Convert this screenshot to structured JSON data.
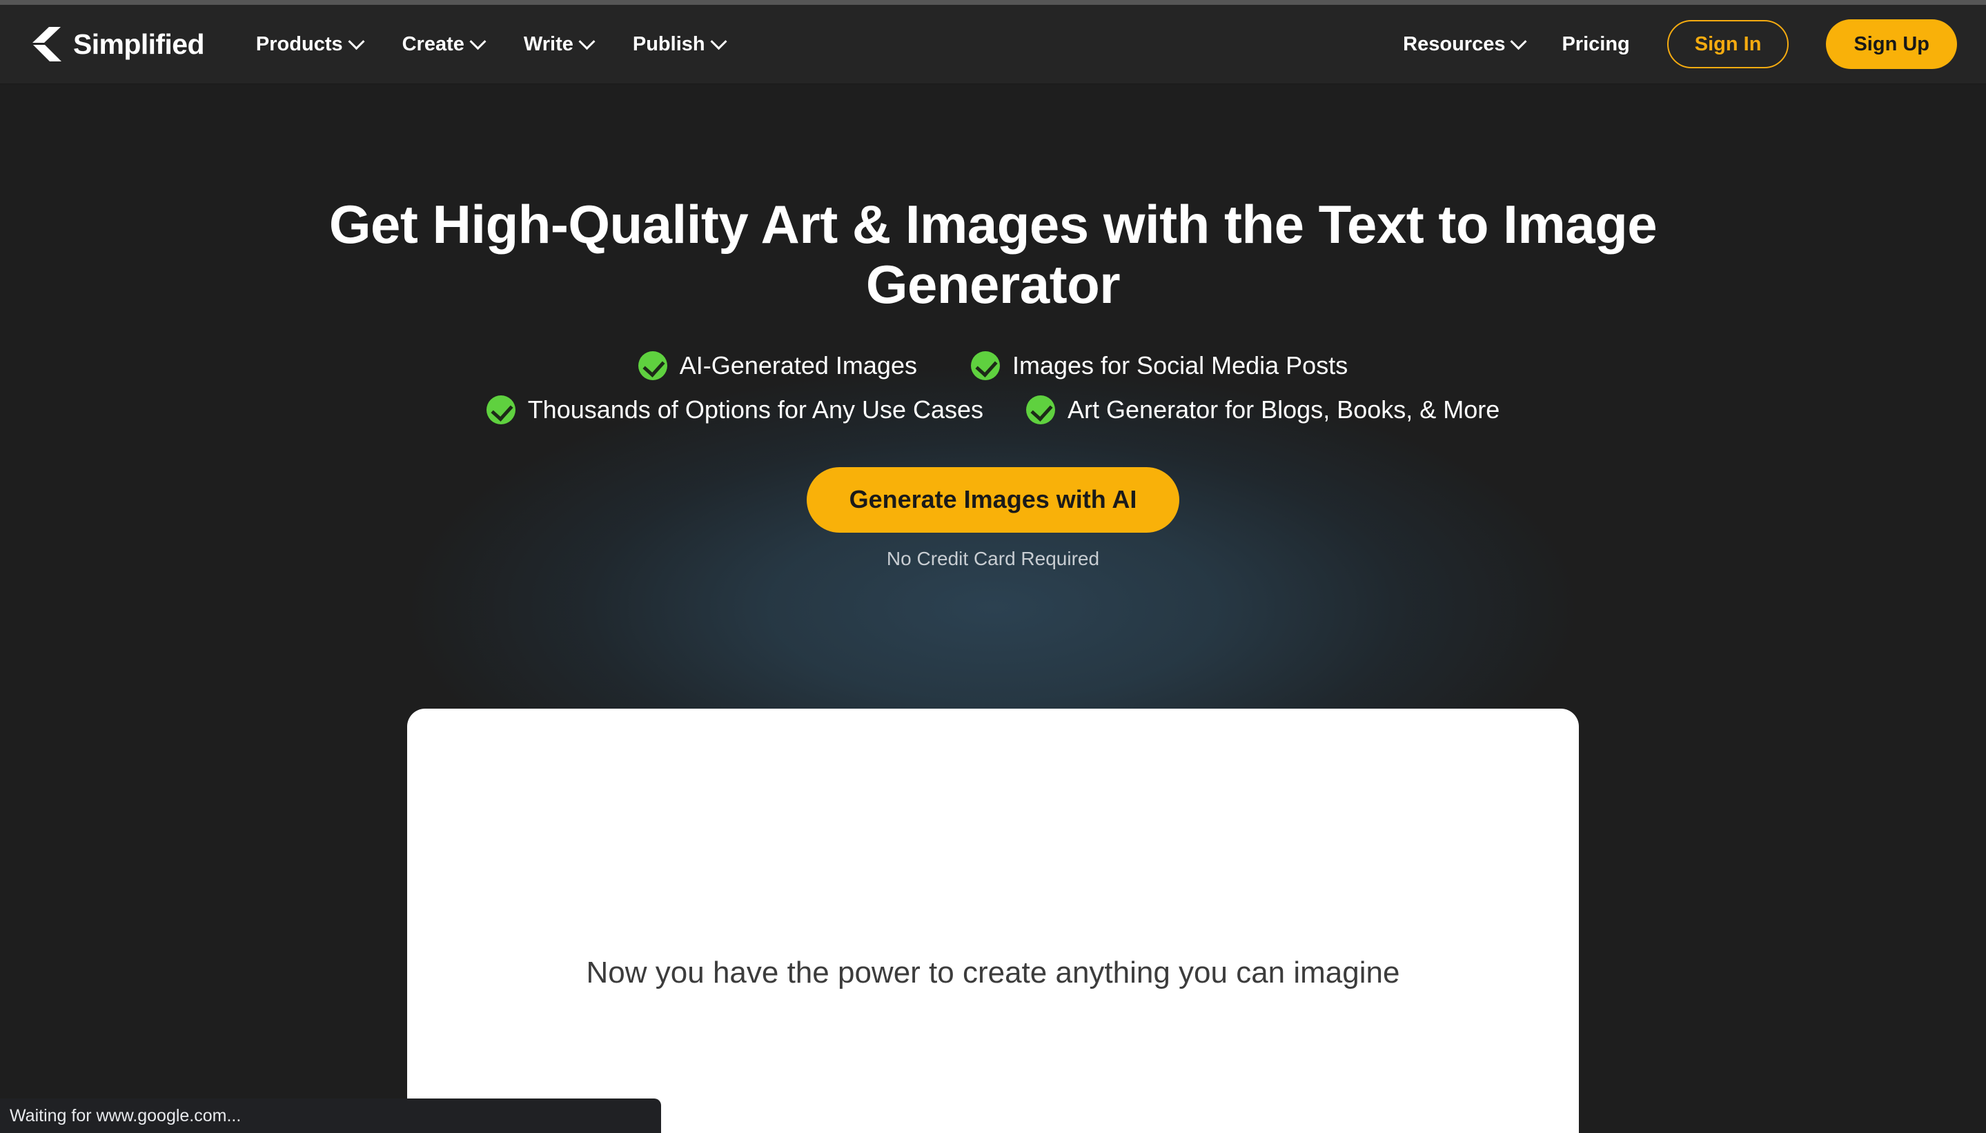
{
  "theme": {
    "page_bg": "#1e1e1e",
    "header_bg": "#252525",
    "accent_amber": "#f9b109",
    "accent_amber_border": "#f5ab10",
    "check_green": "#5fd13f",
    "glow_blue": "#2c4252",
    "card_bg": "#ffffff",
    "status_bg": "#202124"
  },
  "header": {
    "brand_name": "Simplified",
    "brand_logo_icon": "simplified-logo-icon",
    "nav_items": [
      {
        "label": "Products",
        "has_dropdown": true,
        "icon": "chevron-down-icon"
      },
      {
        "label": "Create",
        "has_dropdown": true,
        "icon": "chevron-down-icon"
      },
      {
        "label": "Write",
        "has_dropdown": true,
        "icon": "chevron-down-icon"
      },
      {
        "label": "Publish",
        "has_dropdown": true,
        "icon": "chevron-down-icon"
      }
    ],
    "right_items": [
      {
        "label": "Resources",
        "has_dropdown": true,
        "icon": "chevron-down-icon"
      },
      {
        "label": "Pricing",
        "has_dropdown": false
      }
    ],
    "sign_in_label": "Sign In",
    "sign_up_label": "Sign Up"
  },
  "hero": {
    "title": "Get High-Quality Art & Images with the Text to Image Generator",
    "features": [
      {
        "label": "AI-Generated Images",
        "icon": "check-circle-icon"
      },
      {
        "label": "Images for Social Media Posts",
        "icon": "check-circle-icon"
      },
      {
        "label": "Thousands of Options for Any Use Cases",
        "icon": "check-circle-icon"
      },
      {
        "label": "Art Generator for Blogs, Books, & More",
        "icon": "check-circle-icon"
      }
    ],
    "cta_label": "Generate Images with AI",
    "cta_note": "No Credit Card Required"
  },
  "preview_card": {
    "caption": "Now you have the power to create anything you can imagine"
  },
  "browser": {
    "status_text": "Waiting for www.google.com..."
  }
}
